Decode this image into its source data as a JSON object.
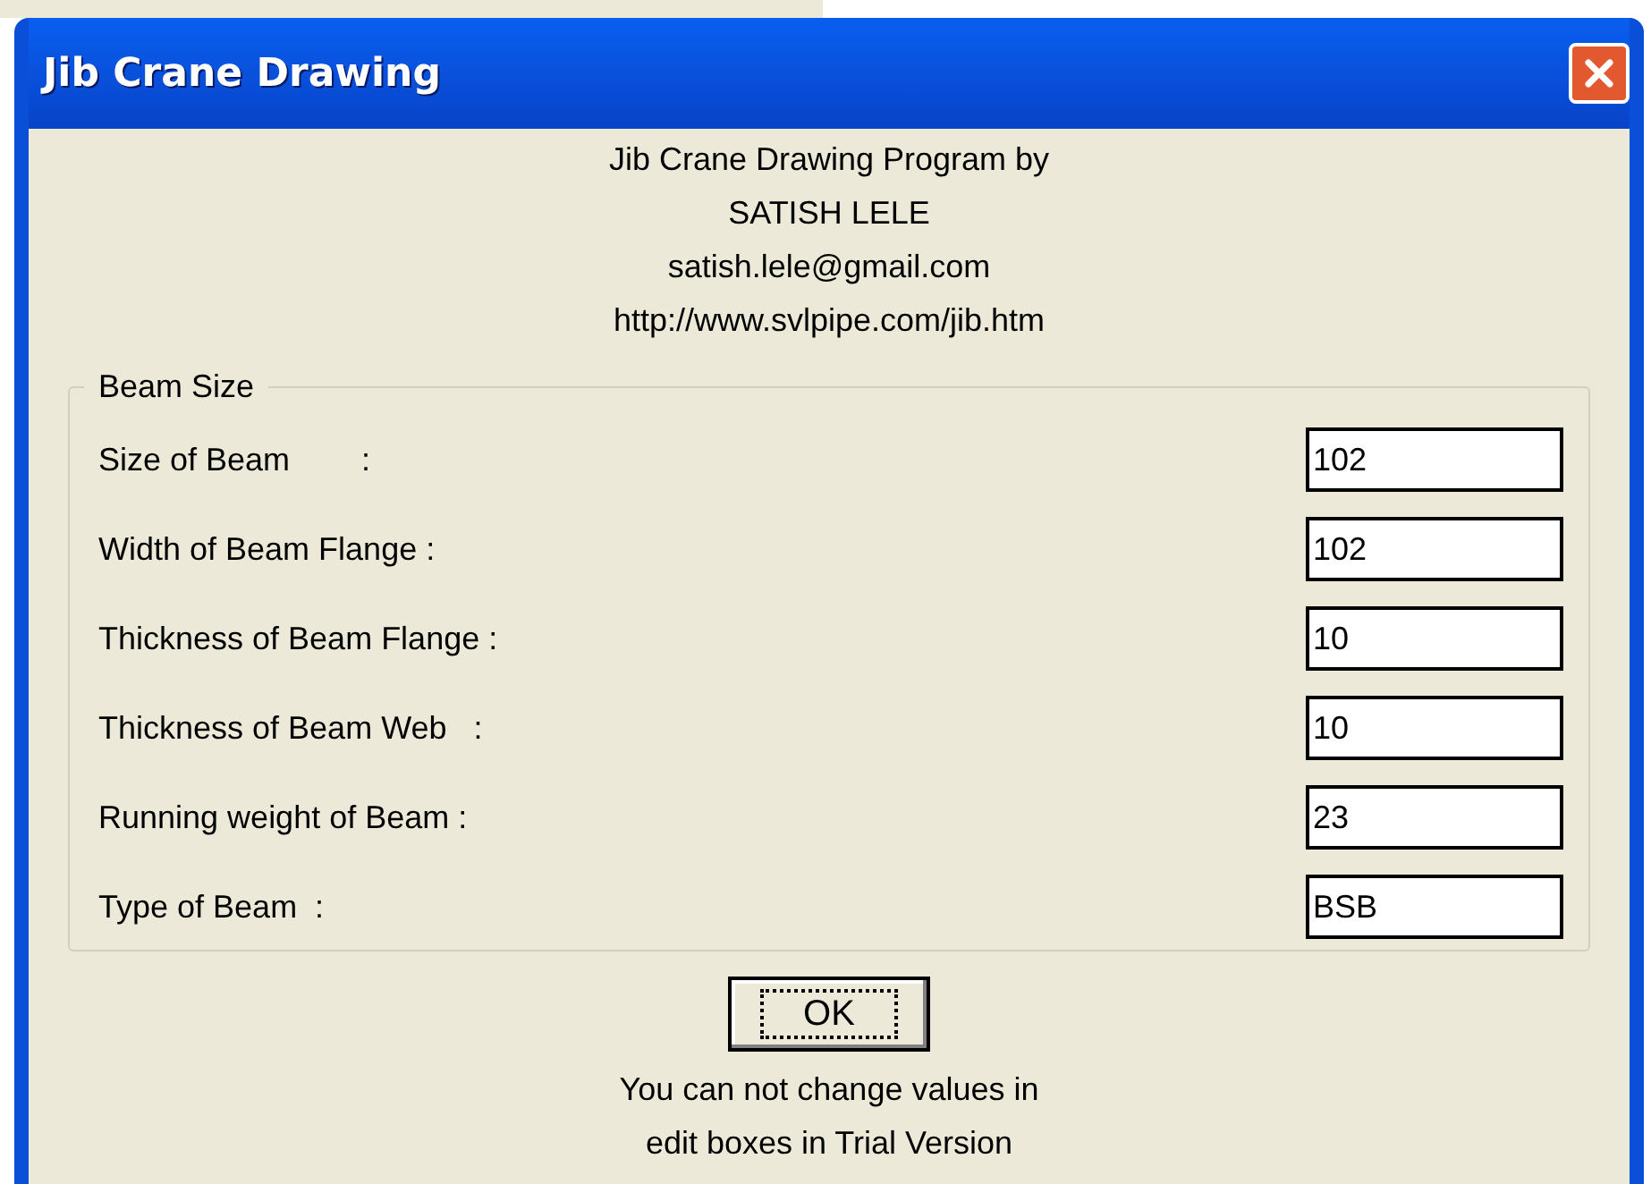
{
  "window": {
    "title": "Jib Crane Drawing"
  },
  "header_lines": [
    "Jib Crane Drawing Program by",
    "SATISH LELE",
    "satish.lele@gmail.com",
    "http://www.svlpipe.com/jib.htm"
  ],
  "group": {
    "title": "Beam Size",
    "fields": [
      {
        "label": "Size of Beam        :",
        "value": "102"
      },
      {
        "label": "Width of Beam Flange :",
        "value": "102"
      },
      {
        "label": "Thickness of Beam Flange :",
        "value": "10"
      },
      {
        "label": "Thickness of Beam Web   :",
        "value": "10"
      },
      {
        "label": "Running weight of Beam :",
        "value": "23"
      },
      {
        "label": "Type of Beam  :",
        "value": "BSB"
      }
    ]
  },
  "buttons": [
    "OK"
  ],
  "note_lines": [
    "You can not change values in",
    "edit boxes in Trial Version"
  ]
}
